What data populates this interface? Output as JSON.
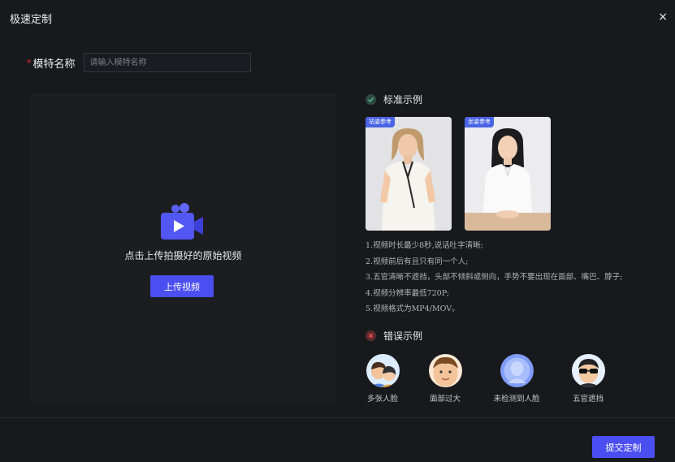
{
  "dialog": {
    "title": "极速定制",
    "close_symbol": "×"
  },
  "form": {
    "required_mark": "*",
    "name_label": "模特名称",
    "name_value": "",
    "name_placeholder": "请输入模特名称"
  },
  "upload": {
    "hint": "点击上传拍摄好的原始视频",
    "button_label": "上传视频",
    "icon": "video-camera-icon"
  },
  "standard": {
    "title": "标准示例",
    "icon": "check-circle-icon",
    "samples": [
      {
        "tag": "站姿参考"
      },
      {
        "tag": "坐姿参考"
      }
    ],
    "rules": [
      "1.视频时长最少8秒,说话吐字清晰;",
      "2.视频前后有且只有同一个人;",
      "3.五官清晰不遮挡，头部不倾斜或侧向，手势不要出现在面部、嘴巴、脖子;",
      "4.视频分辨率最低720P;",
      "5.视频格式为MP4/MOV。"
    ]
  },
  "wrong": {
    "title": "错误示例",
    "icon": "error-circle-icon",
    "items": [
      {
        "label": "多张人脸"
      },
      {
        "label": "面部过大"
      },
      {
        "label": "未检测到人脸"
      },
      {
        "label": "五官遮挡"
      }
    ]
  },
  "footer": {
    "submit_label": "提交定制"
  },
  "colors": {
    "accent": "#4b4ef0",
    "background": "#18191d",
    "tag": "#4a63e6"
  }
}
